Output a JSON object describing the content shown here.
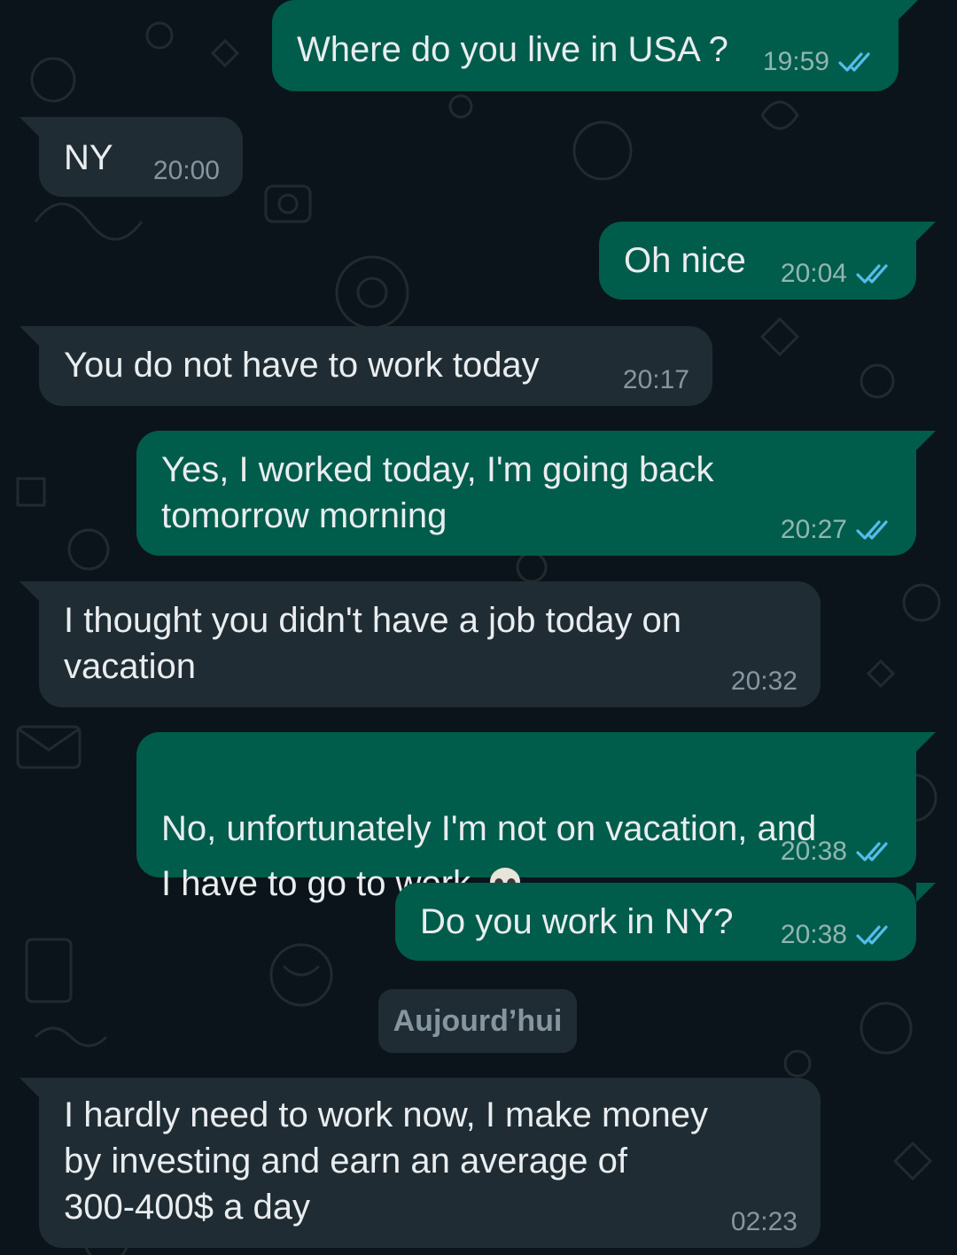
{
  "colors": {
    "background": "#0b141a",
    "outgoing_bubble": "#005c4b",
    "incoming_bubble": "#202c33",
    "read_ticks": "#53bdeb",
    "text": "#e9edef",
    "meta_text": "#8696a0"
  },
  "messages": [
    {
      "direction": "outgoing",
      "text": "Where do you live in USA ?",
      "time": "19:59",
      "status": "read"
    },
    {
      "direction": "incoming",
      "text": "NY",
      "time": "20:00"
    },
    {
      "direction": "outgoing",
      "text": "Oh nice",
      "time": "20:04",
      "status": "read"
    },
    {
      "direction": "incoming",
      "text": "You do not have to work today",
      "time": "20:17"
    },
    {
      "direction": "outgoing",
      "text": "Yes, I worked today, I'm going back\ntomorrow morning",
      "time": "20:27",
      "status": "read"
    },
    {
      "direction": "incoming",
      "text": "I thought you didn't have a job today on\nvacation",
      "time": "20:32"
    },
    {
      "direction": "outgoing",
      "text": "No, unfortunately I'm not on vacation, and\nI have to go to work",
      "emoji": "skull-emoji",
      "time": "20:38",
      "status": "read"
    },
    {
      "direction": "outgoing",
      "text": "Do you work in NY?",
      "time": "20:38",
      "status": "read"
    },
    {
      "direction": "incoming",
      "text": "I hardly need to work now, I make money\nby investing and earn an average of\n300-400$ a day",
      "time": "02:23"
    }
  ],
  "date_separator": "Aujourd’hui"
}
